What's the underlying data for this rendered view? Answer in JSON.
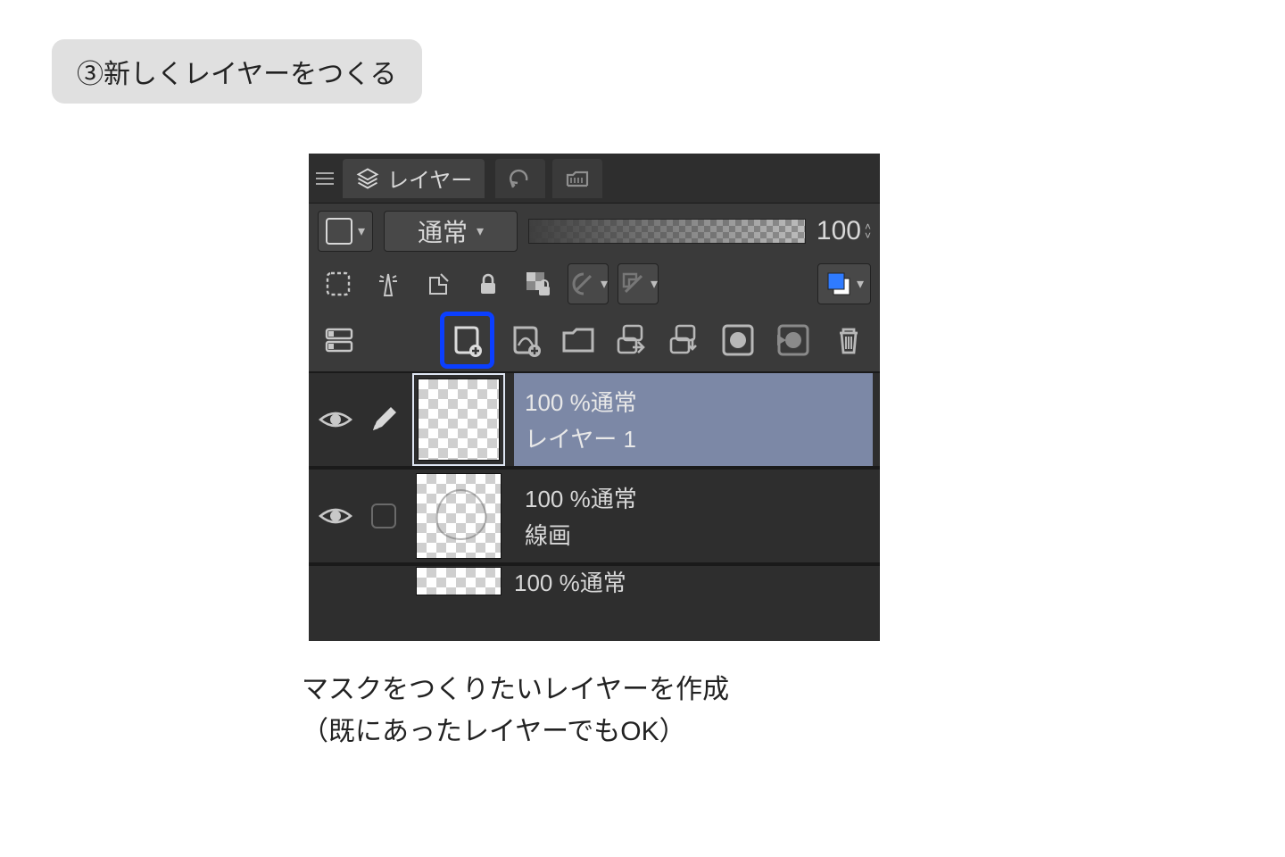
{
  "step": {
    "label": "③新しくレイヤーをつくる"
  },
  "panel": {
    "tab_label": "レイヤー",
    "blend_mode": "通常",
    "opacity_value": "100"
  },
  "layers": [
    {
      "opacity_line": "100 %通常",
      "name": "レイヤー 1",
      "selected": true,
      "editing": true,
      "sketch": false
    },
    {
      "opacity_line": "100 %通常",
      "name": "線画",
      "selected": false,
      "editing": false,
      "sketch": true
    }
  ],
  "partial_layer": {
    "opacity_line": "100 %通常"
  },
  "caption": {
    "line1": "マスクをつくりたいレイヤーを作成",
    "line2": "（既にあったレイヤーでもOK）"
  }
}
